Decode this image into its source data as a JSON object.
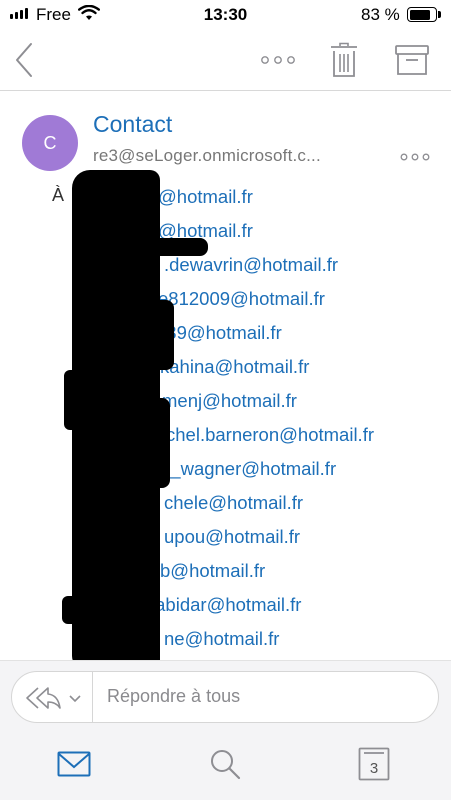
{
  "status_bar": {
    "carrier": "Free",
    "time": "13:30",
    "battery_percent": "83 %",
    "battery_level": 0.83
  },
  "toolbar": {
    "back_icon": "chevron-left-icon",
    "more_icon": "more-horizontal-icon",
    "delete_icon": "trash-icon",
    "archive_icon": "archive-icon"
  },
  "message": {
    "avatar_initial": "C",
    "avatar_color": "#a07ad6",
    "sender_name": "Contact",
    "sender_email": "re3@seLoger.onmicrosoft.c...",
    "to_label": "À",
    "recipients": [
      "@hotmail.fr",
      "@hotmail.fr",
      ".dewavrin@hotmail.fr",
      "e812009@hotmail.fr",
      "339@hotmail.fr",
      "kahina@hotmail.fr",
      "menj@hotmail.fr",
      "chel.barneron@hotmail.fr",
      "e_wagner@hotmail.fr",
      "chele@hotmail.fr",
      "upou@hotmail.fr",
      "b@hotmail.fr",
      ".abidar@hotmail.fr",
      "ne@hotmail.fr"
    ]
  },
  "reply": {
    "placeholder": "Répondre à tous"
  },
  "tabbar": {
    "mail_icon": "mail-icon",
    "search_icon": "search-icon",
    "calendar_icon": "calendar-icon",
    "calendar_day": "3"
  },
  "colors": {
    "accent": "#1d6fb8",
    "icon_gray": "#8e8e93"
  }
}
